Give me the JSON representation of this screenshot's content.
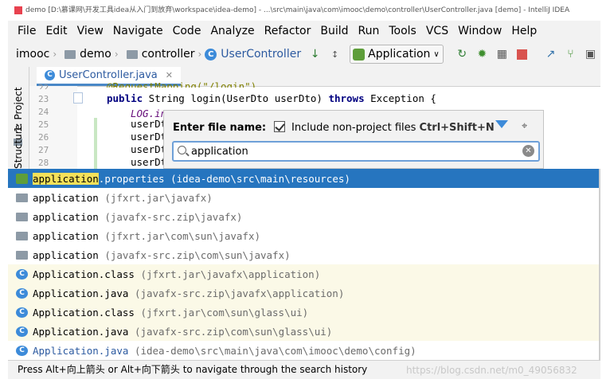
{
  "titlebar": {
    "text": "demo [D:\\慕课网\\开发工具idea从入门到放弃\\workspace\\idea-demo] - ...\\src\\main\\java\\com\\imooc\\demo\\controller\\UserController.java [demo] - IntelliJ IDEA"
  },
  "menu": [
    "File",
    "Edit",
    "View",
    "Navigate",
    "Code",
    "Analyze",
    "Refactor",
    "Build",
    "Run",
    "Tools",
    "VCS",
    "Window",
    "Help"
  ],
  "navbar": {
    "crumbs": [
      "imooc",
      "demo",
      "controller",
      "UserController"
    ],
    "run_config": "Application"
  },
  "editor": {
    "tab": "UserController.java",
    "project_tool": "1: Project",
    "structure_tool": "Structure",
    "line_numbers": [
      "22",
      "23",
      "24",
      "25",
      "26",
      "27",
      "28"
    ],
    "lines": [
      "@RequestMapping(\"/login\")",
      "public String login(UserDto userDto) throws Exception {",
      "LOG.info(\"登录成功, {}\", userDto);",
      "userDt",
      "userDt",
      "userDt",
      "userDt"
    ]
  },
  "popup": {
    "label": "Enter file name:",
    "include_label": "Include non-project files",
    "include_shortcut": "Ctrl+Shift+N",
    "include_checked": true,
    "query": "application"
  },
  "results": [
    {
      "name": "application.properties",
      "path": "(idea-demo\\src\\main\\resources)",
      "icon": "properties-icon",
      "selected": true
    },
    {
      "name": "application",
      "path": "(jfxrt.jar\\javafx)",
      "icon": "folder-icon"
    },
    {
      "name": "application",
      "path": "(javafx-src.zip\\javafx)",
      "icon": "folder-icon"
    },
    {
      "name": "application",
      "path": "(jfxrt.jar\\com\\sun\\javafx)",
      "icon": "folder-icon"
    },
    {
      "name": "application",
      "path": "(javafx-src.zip\\com\\sun\\javafx)",
      "icon": "folder-icon"
    },
    {
      "name": "Application.class",
      "path": "(jfxrt.jar\\javafx\\application)",
      "icon": "class-icon"
    },
    {
      "name": "Application.java",
      "path": "(javafx-src.zip\\javafx\\application)",
      "icon": "class-icon"
    },
    {
      "name": "Application.class",
      "path": "(jfxrt.jar\\com\\sun\\glass\\ui)",
      "icon": "class-icon"
    },
    {
      "name": "Application.java",
      "path": "(javafx-src.zip\\com\\sun\\glass\\ui)",
      "icon": "class-icon"
    },
    {
      "name": "Application.java",
      "path": "(idea-demo\\src\\main\\java\\com\\imooc\\demo\\config)",
      "icon": "spring-class-icon"
    }
  ],
  "status": "Press Alt+向上箭头 or Alt+向下箭头 to navigate through the search history",
  "watermark": "https://blog.csdn.net/m0_49056832",
  "colors": {
    "selection": "#2675bf",
    "match_highlight": "#f5e15a",
    "class_row_bg": "#fbf9e7"
  }
}
